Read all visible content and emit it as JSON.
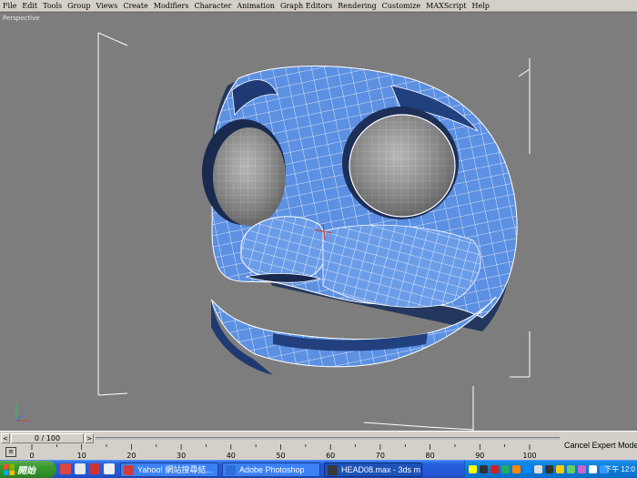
{
  "menu": {
    "items": [
      "File",
      "Edit",
      "Tools",
      "Group",
      "Views",
      "Create",
      "Modifiers",
      "Character",
      "Animation",
      "Graph Editors",
      "Rendering",
      "Customize",
      "MAXScript",
      "Help"
    ]
  },
  "viewport": {
    "label": "Perspective"
  },
  "timeline": {
    "frame_display": "0 / 100",
    "left_arrow": "<",
    "right_arrow": ">",
    "ticks": [
      "0",
      "10",
      "20",
      "30",
      "40",
      "50",
      "60",
      "70",
      "80",
      "90",
      "100"
    ],
    "status": "Cancel Expert Mode"
  },
  "taskbar": {
    "start_label": "開始",
    "buttons": [
      {
        "label": "Yahoo! 網站搜尋結...",
        "icon_color": "#d23c3c"
      },
      {
        "label": "Adobe Photoshop",
        "icon_color": "#2d6fd6"
      },
      {
        "label": "HEAD08.max - 3ds m...",
        "icon_color": "#3a3a3a"
      }
    ],
    "clock": "下午 12:0"
  },
  "colors": {
    "model_blue": "#5b8fe0",
    "model_dark": "#1f3c78",
    "eyeball": "#a8a8a8",
    "viewport_bg": "#7d7d7d"
  }
}
